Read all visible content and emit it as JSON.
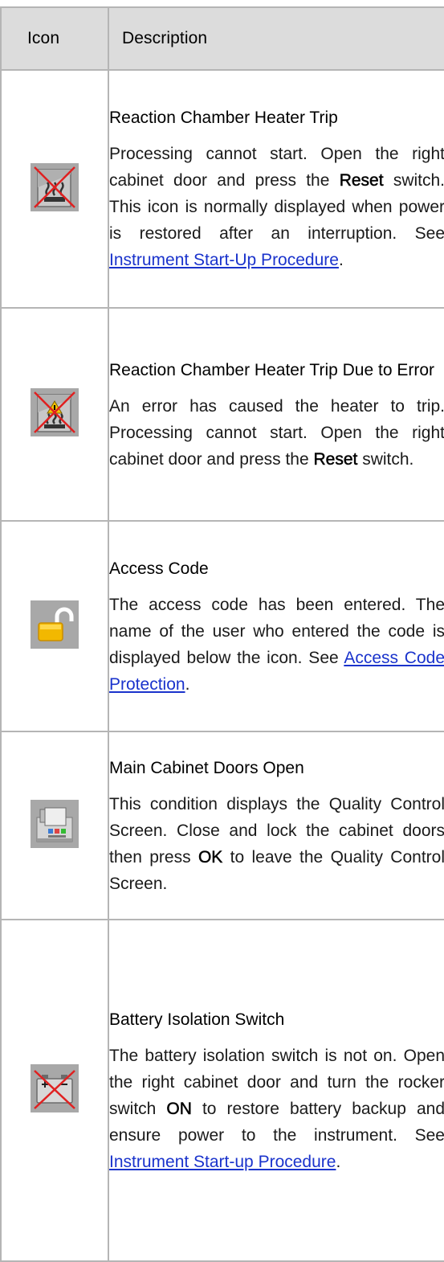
{
  "table": {
    "header": {
      "icon": "Icon",
      "description": "Description"
    },
    "rows": [
      {
        "icon_name": "heater-trip-icon",
        "title": "Reaction Chamber Heater Trip",
        "body_1": "Processing cannot start. Open the right cabinet door and press the ",
        "bold": "Reset",
        "body_2": " switch. This icon is normally displayed when power is restored after an interruption. See ",
        "link": "Instrument Start-Up Procedure",
        "body_3": "."
      },
      {
        "icon_name": "heater-trip-error-icon",
        "title": "Reaction Chamber Heater Trip Due to Error",
        "body_1": "An error has caused the heater to trip. Processing cannot start. Open the right cabinet door and press the ",
        "bold": "Reset",
        "body_2": " switch."
      },
      {
        "icon_name": "access-code-unlocked-icon",
        "title": "Access Code",
        "body_1": "The access code has been entered. The name of the user who entered the code is displayed below the icon. See ",
        "link": "Access Code Protection",
        "body_2": "."
      },
      {
        "icon_name": "cabinet-doors-open-icon",
        "title": "Main Cabinet Doors Open",
        "body_1": "This condition displays the Quality Control Screen. Close and lock the cabinet doors then press ",
        "bold": "OK",
        "body_2": " to leave the Quality Control Screen."
      },
      {
        "icon_name": "battery-isolation-icon",
        "title": "Battery Isolation Switch",
        "body_1": "The battery isolation switch is not on. Open the right cabinet door and turn the rocker switch ",
        "bold": "ON",
        "body_2": " to restore battery backup and ensure power to the instrument. See ",
        "link": "Instrument Start-up Procedure",
        "body_3": "."
      }
    ]
  }
}
